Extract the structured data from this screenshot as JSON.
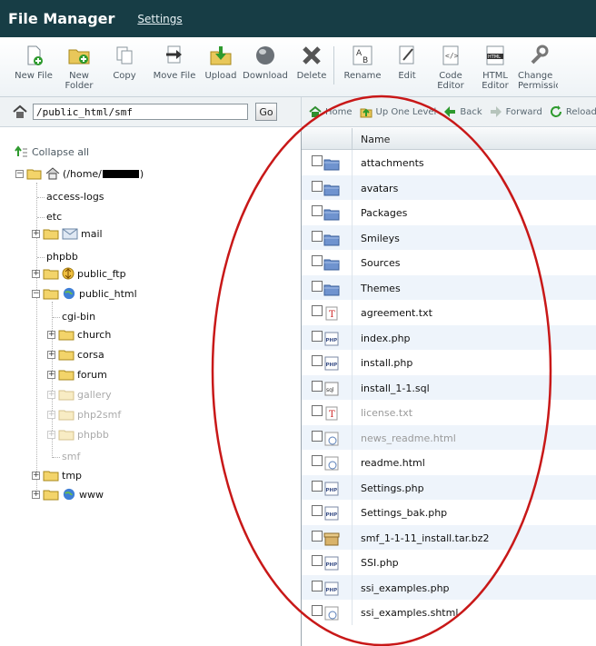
{
  "header": {
    "title": "File Manager",
    "settings_link": "Settings"
  },
  "toolbar": [
    {
      "icon": "new-file-icon",
      "lines": [
        "New File"
      ]
    },
    {
      "icon": "new-folder-icon",
      "lines": [
        "New",
        "Folder"
      ]
    },
    {
      "icon": "copy-icon",
      "lines": [
        "Copy"
      ]
    },
    {
      "icon": "move-file-icon",
      "lines": [
        "Move File"
      ]
    },
    {
      "icon": "upload-icon",
      "lines": [
        "Upload"
      ]
    },
    {
      "icon": "download-icon",
      "lines": [
        "Download"
      ]
    },
    {
      "icon": "delete-icon",
      "lines": [
        "Delete"
      ]
    },
    {
      "icon": "rename-icon",
      "lines": [
        "Rename"
      ]
    },
    {
      "icon": "edit-icon",
      "lines": [
        "Edit"
      ]
    },
    {
      "icon": "code-editor-icon",
      "lines": [
        "Code",
        "Editor"
      ]
    },
    {
      "icon": "html-editor-icon",
      "lines": [
        "HTML",
        "Editor"
      ]
    },
    {
      "icon": "change-permissions-icon",
      "lines": [
        "Change",
        "Permissions"
      ]
    }
  ],
  "pathbar": {
    "path_value": "/public_html/smf",
    "go_label": "Go"
  },
  "navbar": [
    {
      "icon": "home-icon",
      "label": "Home"
    },
    {
      "icon": "up-folder-icon",
      "label": "Up One Level"
    },
    {
      "icon": "back-arrow-icon",
      "label": "Back"
    },
    {
      "icon": "forward-arrow-icon",
      "label": "Forward"
    },
    {
      "icon": "reload-icon",
      "label": "Reload"
    }
  ],
  "tree": {
    "collapse_all": "Collapse all",
    "root_label": "(/home/",
    "root_suffix": ")",
    "nodes": [
      {
        "label": "access-logs"
      },
      {
        "label": "etc"
      },
      {
        "label": "mail"
      },
      {
        "label": "phpbb"
      },
      {
        "label": "public_ftp"
      },
      {
        "label": "public_html"
      },
      {
        "label": "cgi-bin"
      },
      {
        "label": "church"
      },
      {
        "label": "corsa"
      },
      {
        "label": "forum"
      },
      {
        "label": "gallery"
      },
      {
        "label": "php2smf"
      },
      {
        "label": "phpbb"
      },
      {
        "label": "smf"
      },
      {
        "label": "tmp"
      },
      {
        "label": "www"
      }
    ]
  },
  "list": {
    "column_name": "Name",
    "files": [
      {
        "name": "attachments",
        "type": "folder"
      },
      {
        "name": "avatars",
        "type": "folder"
      },
      {
        "name": "Packages",
        "type": "folder"
      },
      {
        "name": "Smileys",
        "type": "folder"
      },
      {
        "name": "Sources",
        "type": "folder"
      },
      {
        "name": "Themes",
        "type": "folder"
      },
      {
        "name": "agreement.txt",
        "type": "text"
      },
      {
        "name": "index.php",
        "type": "php"
      },
      {
        "name": "install.php",
        "type": "php"
      },
      {
        "name": "install_1-1.sql",
        "type": "sql"
      },
      {
        "name": "license.txt",
        "type": "text"
      },
      {
        "name": "news_readme.html",
        "type": "html"
      },
      {
        "name": "readme.html",
        "type": "html"
      },
      {
        "name": "Settings.php",
        "type": "php"
      },
      {
        "name": "Settings_bak.php",
        "type": "php"
      },
      {
        "name": "smf_1-1-11_install.tar.bz2",
        "type": "archive"
      },
      {
        "name": "SSI.php",
        "type": "php"
      },
      {
        "name": "ssi_examples.php",
        "type": "php"
      },
      {
        "name": "ssi_examples.shtml",
        "type": "html"
      }
    ]
  },
  "colors": {
    "header_bg": "#173d45",
    "annotation_oval": "#c81818",
    "row_alt": "#eef4fb"
  }
}
